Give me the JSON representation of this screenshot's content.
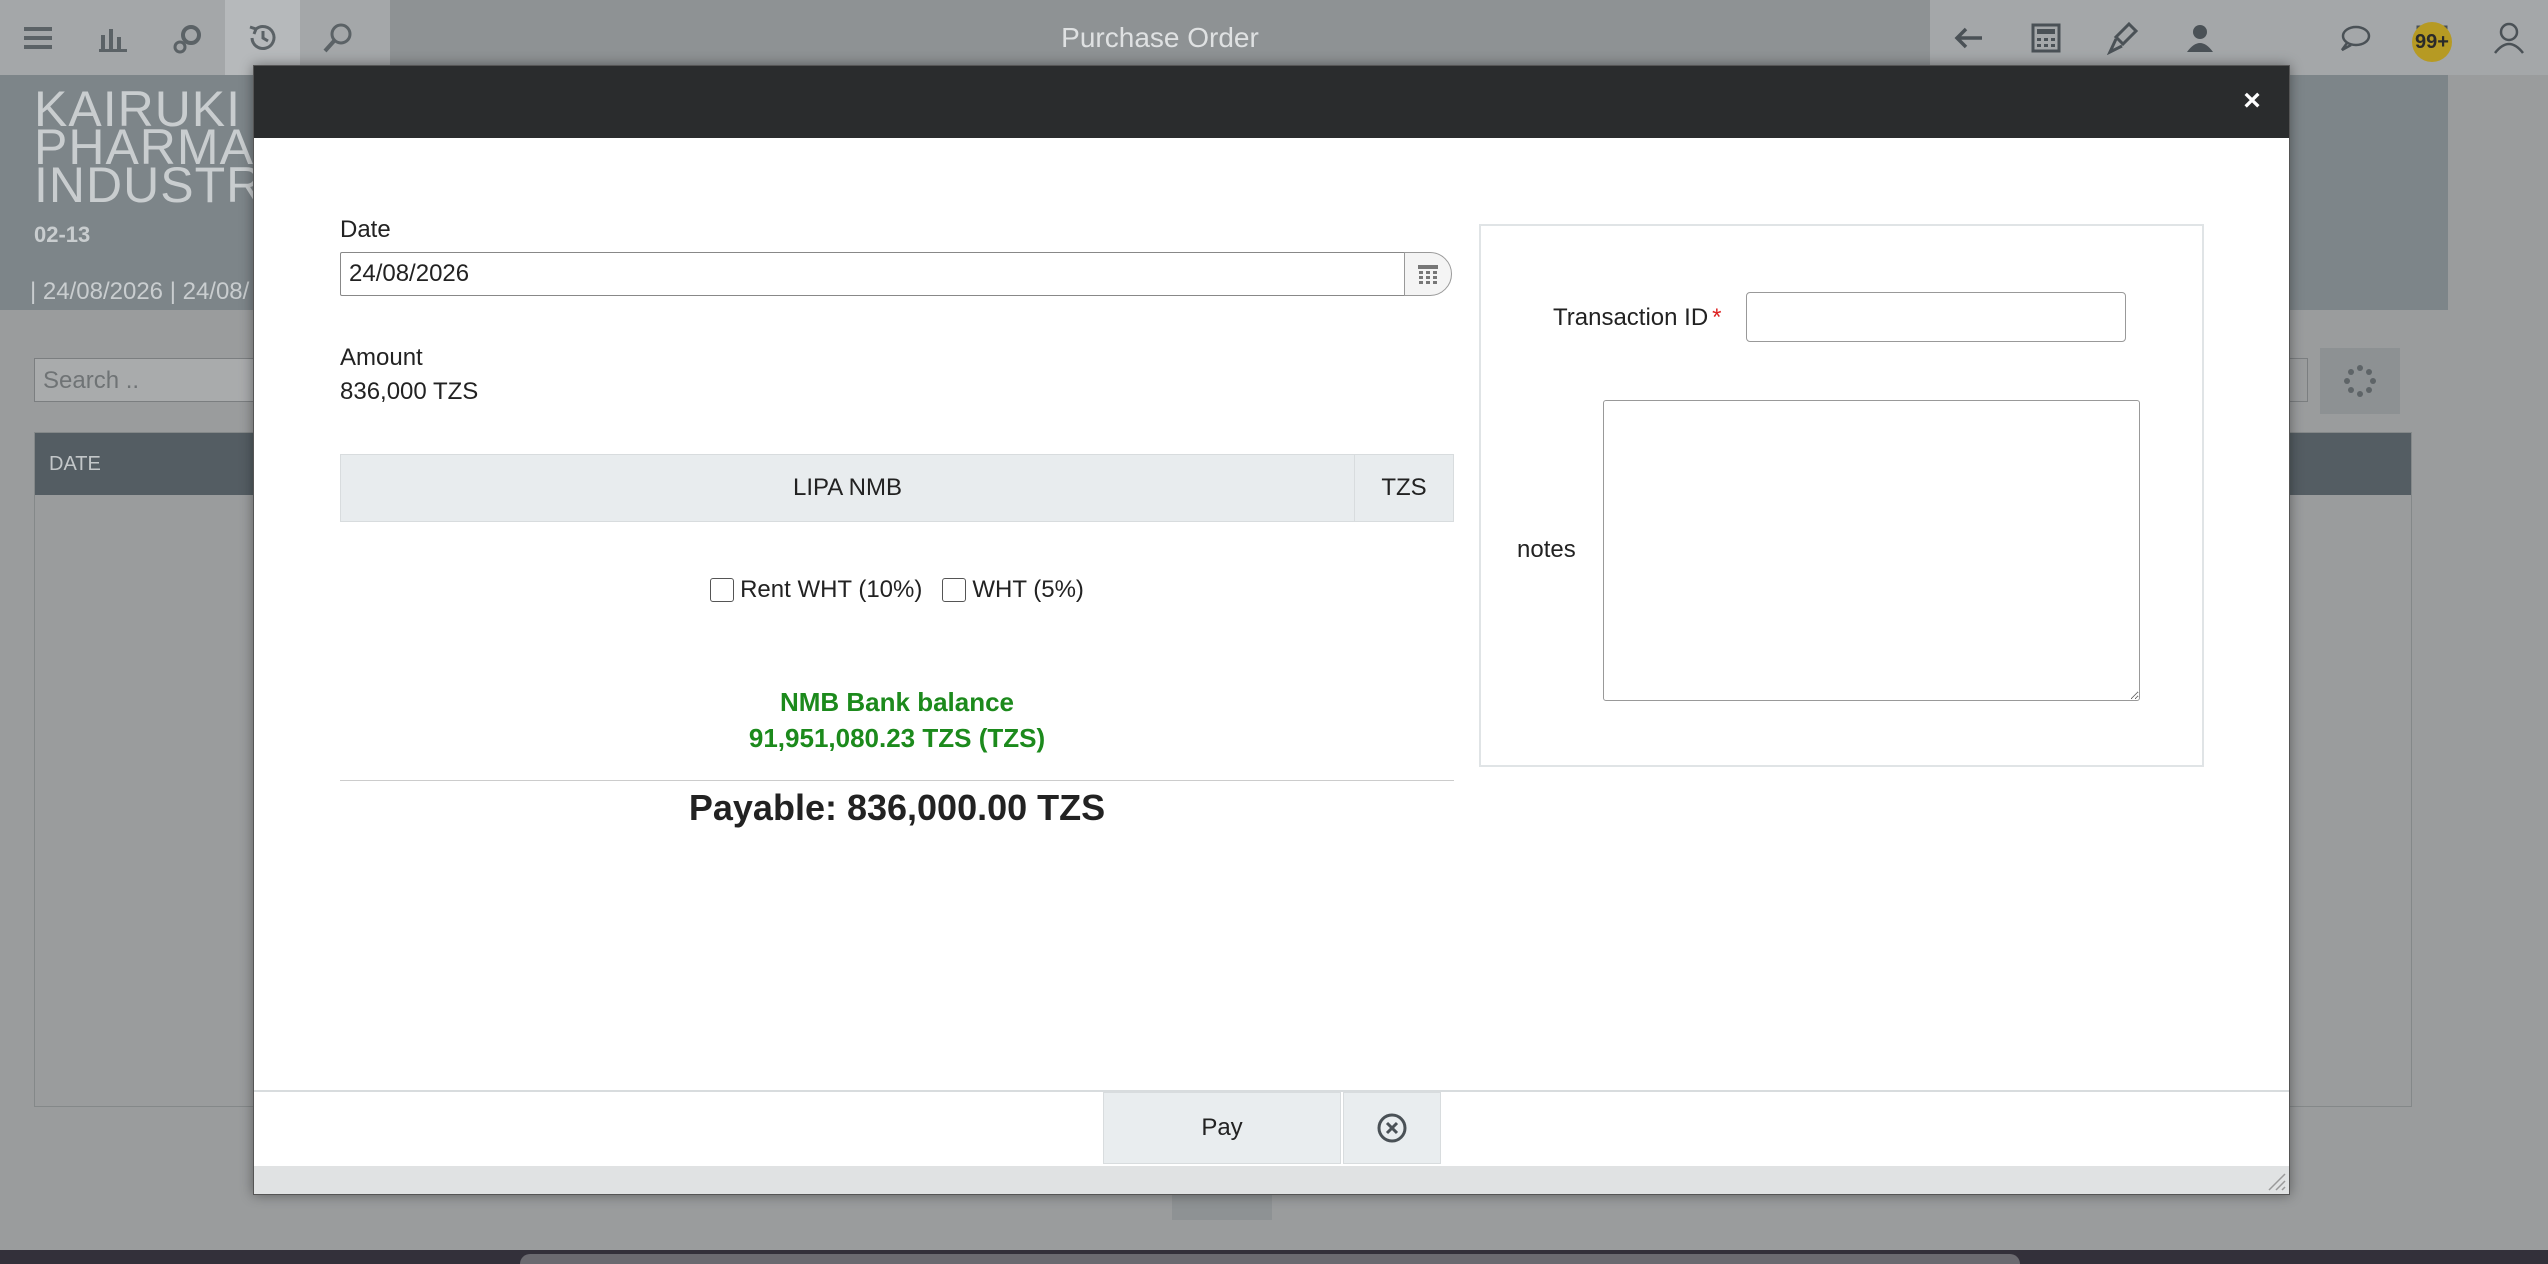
{
  "app": {
    "title": "Purchase Order",
    "notification_badge": "99+"
  },
  "left_toolbar": [
    "menu-icon",
    "chart-icon",
    "settings-icon",
    "history-icon",
    "search-icon"
  ],
  "right_toolbar": [
    "back-arrow-icon",
    "calculator-icon",
    "brush-icon",
    "user-icon",
    "chat-icon",
    "mail-icon",
    "profile-icon"
  ],
  "background_page": {
    "company_name": "KAIRUKI\nPHARMA\nINDUSTR",
    "code": "02-13",
    "date_range": "| 24/08/2026 | 24/08/",
    "search_placeholder": "Search ..",
    "table_header_date": "DATE"
  },
  "modal": {
    "date_label": "Date",
    "date_value": "24/08/2026",
    "amount_label": "Amount",
    "amount_value": "836,000 TZS",
    "payment_method": {
      "name": "LIPA NMB",
      "currency": "TZS"
    },
    "wht_options": [
      {
        "label": "Rent WHT (10%)",
        "checked": false
      },
      {
        "label": "WHT (5%)",
        "checked": false
      }
    ],
    "balance_title": "NMB Bank balance",
    "balance_value": "91,951,080.23 TZS (TZS)",
    "payable": "Payable: 836,000.00 TZS",
    "transaction_id_label": "Transaction ID",
    "transaction_id_required": "*",
    "transaction_id_value": "",
    "notes_label": "notes",
    "notes_value": "",
    "pay_button": "Pay",
    "close_symbol": "×"
  },
  "colors": {
    "balance_green": "#1c8a1c",
    "modal_titlebar": "#2a2c2d",
    "required_red": "#dd2222",
    "badge": "#b69a23"
  }
}
